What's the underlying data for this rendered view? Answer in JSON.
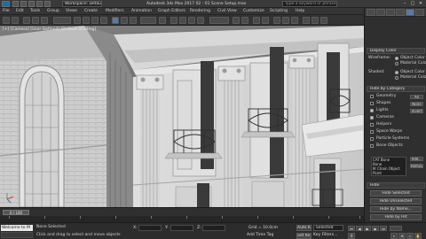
{
  "titlebar": {
    "workspace": "Workspace: Default",
    "filename": "Autodesk 3ds Max 2017  02 - 01 Scene Setup.max",
    "search_placeholder": "Type a keyword or phrase"
  },
  "menubar": {
    "items": [
      "File",
      "Edit",
      "Tools",
      "Group",
      "Views",
      "Create",
      "Modifiers",
      "Animation",
      "Graph Editors",
      "Rendering",
      "Civil View",
      "Customize",
      "Scripting",
      "Help"
    ]
  },
  "viewport": {
    "label": "[+] [Camera] [User Defined] [Default Shading]"
  },
  "timeline": {
    "frame": "0 / 100"
  },
  "statusbar": {
    "maxscript": "Welcome to M",
    "selection": "None Selected",
    "prompt": "Click and drag to select and move objects",
    "x_label": "X:",
    "y_label": "Y:",
    "z_label": "Z:",
    "grid": "Grid = 10.0cm",
    "add_time_tag": "Add Time Tag",
    "auto_key": "Auto Key",
    "set_key": "Set Key",
    "selected": "Selected",
    "key_filters": "Key Filters..."
  },
  "cmdpanel": {
    "display_color": "Display Color",
    "wireframe": "Wireframe:",
    "shaded": "Shaded:",
    "object_color": "Object Color",
    "material_color": "Material Color",
    "hide_by_category": "Hide by Category",
    "categories": [
      {
        "label": "Geometry",
        "checked": false
      },
      {
        "label": "Shapes",
        "checked": false
      },
      {
        "label": "Lights",
        "checked": true
      },
      {
        "label": "Cameras",
        "checked": true
      },
      {
        "label": "Helpers",
        "checked": false
      },
      {
        "label": "Space Warps",
        "checked": false
      },
      {
        "label": "Particle Systems",
        "checked": false
      },
      {
        "label": "Bone Objects",
        "checked": false
      }
    ],
    "side_buttons": [
      "All",
      "None",
      "Invert"
    ],
    "list_items": [
      "CAT Bone",
      "Bone",
      "IK Chain Object",
      "Point"
    ],
    "add": "Add...",
    "remove": "Remove",
    "hide": "Hide",
    "hide_buttons": [
      "Hide Selected",
      "Hide Unselected",
      "Hide by Name...",
      "Hide by Hit"
    ],
    "colors": {
      "wire_swatch": "#a84b4b",
      "shaded_swatch": "#9c9c9c"
    }
  }
}
